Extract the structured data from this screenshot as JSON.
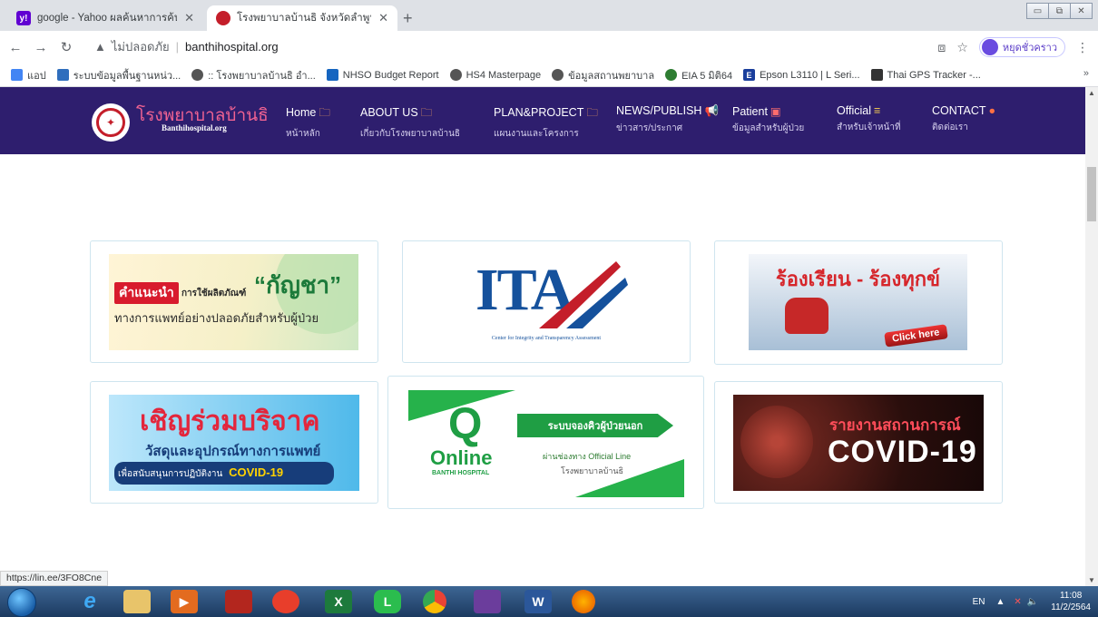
{
  "browser": {
    "tabs": [
      {
        "title": "google - Yahoo ผลค้นหาการค้นหา",
        "active": false,
        "favicon_color": "#6001d2"
      },
      {
        "title": "โรงพยาบาลบ้านธิ จังหวัดลำพูน",
        "active": true,
        "favicon_color": "#c41e2a"
      }
    ],
    "new_tab_icon": "+",
    "omnibox": {
      "security_label": "ไม่ปลอดภัย",
      "url": "banthihospital.org"
    },
    "profile_label": "หยุดชั่วคราว",
    "bookmarks": [
      {
        "label": "แอป",
        "color": "#4285f4"
      },
      {
        "label": "ระบบข้อมูลพื้นฐานหน่ว...",
        "color": "#2f6ebd"
      },
      {
        "label": ":: โรงพยาบาลบ้านธิ อำ...",
        "color": "#555555"
      },
      {
        "label": "NHSO Budget Report",
        "color": "#1565c0"
      },
      {
        "label": "HS4 Masterpage",
        "color": "#555555"
      },
      {
        "label": "ข้อมูลสถานพยาบาล",
        "color": "#555555"
      },
      {
        "label": "EIA 5 มิติ64",
        "color": "#2e7d32"
      },
      {
        "label": "Epson L3110 | L Seri...",
        "color": "#1a3e9c"
      },
      {
        "label": "Thai GPS Tracker -...",
        "color": "#333333"
      }
    ],
    "bookmarks_more": "»",
    "status_url": "https://lin.ee/3FO8Cne"
  },
  "site": {
    "brand_th": "โรงพยาบาลบ้านธิ",
    "brand_en": "Banthihospital.org",
    "menu": [
      {
        "label": "Home",
        "sub": "หน้าหลัก",
        "icon": "folder-icon"
      },
      {
        "label": "ABOUT US",
        "sub": "เกี่ยวกับโรงพยาบาลบ้านธิ",
        "icon": "folder-icon"
      },
      {
        "label": "PLAN&PROJECT",
        "sub": "แผนงานและโครงการ",
        "icon": "folder-icon"
      },
      {
        "label": "NEWS/PUBLISH",
        "sub": "ข่าวสาร/ประกาศ",
        "icon": "megaphone-icon"
      },
      {
        "label": "Patient",
        "sub": "ข้อมูลสำหรับผู้ป่วย",
        "icon": "image-icon"
      },
      {
        "label": "Official",
        "sub": "สำหรับเจ้าหน้าที่",
        "icon": "menu-icon"
      },
      {
        "label": "CONTACT",
        "sub": "ติดต่อเรา",
        "icon": "help-icon"
      }
    ],
    "cards": [
      {
        "name": "cannabis-guide",
        "badge": "คำแนะนำ",
        "line1": "การใช้ผลิตภัณฑ์",
        "highlight": "“กัญชา”",
        "line2": "ทางการแพทย์อย่างปลอดภัยสำหรับผู้ป่วย"
      },
      {
        "name": "ita",
        "title": "ITA",
        "caption": "Center for Integrity and Transparency Assessment"
      },
      {
        "name": "complaint",
        "title": "ร้องเรียน - ร้องทุกข์",
        "cta": "Click here"
      },
      {
        "name": "donation",
        "title": "เชิญร่วมบริจาค",
        "line1": "วัสดุและอุปกรณ์ทางการแพทย์",
        "line2": "เพื่อสนับสนุนการปฏิบัติงาน",
        "highlight": "COVID-19"
      },
      {
        "name": "queue",
        "q": "Q",
        "online": "Online",
        "hospital": "BANTHI HOSPITAL",
        "title": "ระบบจองคิวผู้ป่วยนอก",
        "line1": "ผ่านช่องทาง Official Line",
        "line2": "โรงพยาบาลบ้านธิ"
      },
      {
        "name": "covid-report",
        "title": "รายงานสถานการณ์",
        "highlight": "COVID-19"
      }
    ]
  },
  "taskbar": {
    "language": "EN",
    "time": "11:08",
    "date": "11/2/2564"
  }
}
